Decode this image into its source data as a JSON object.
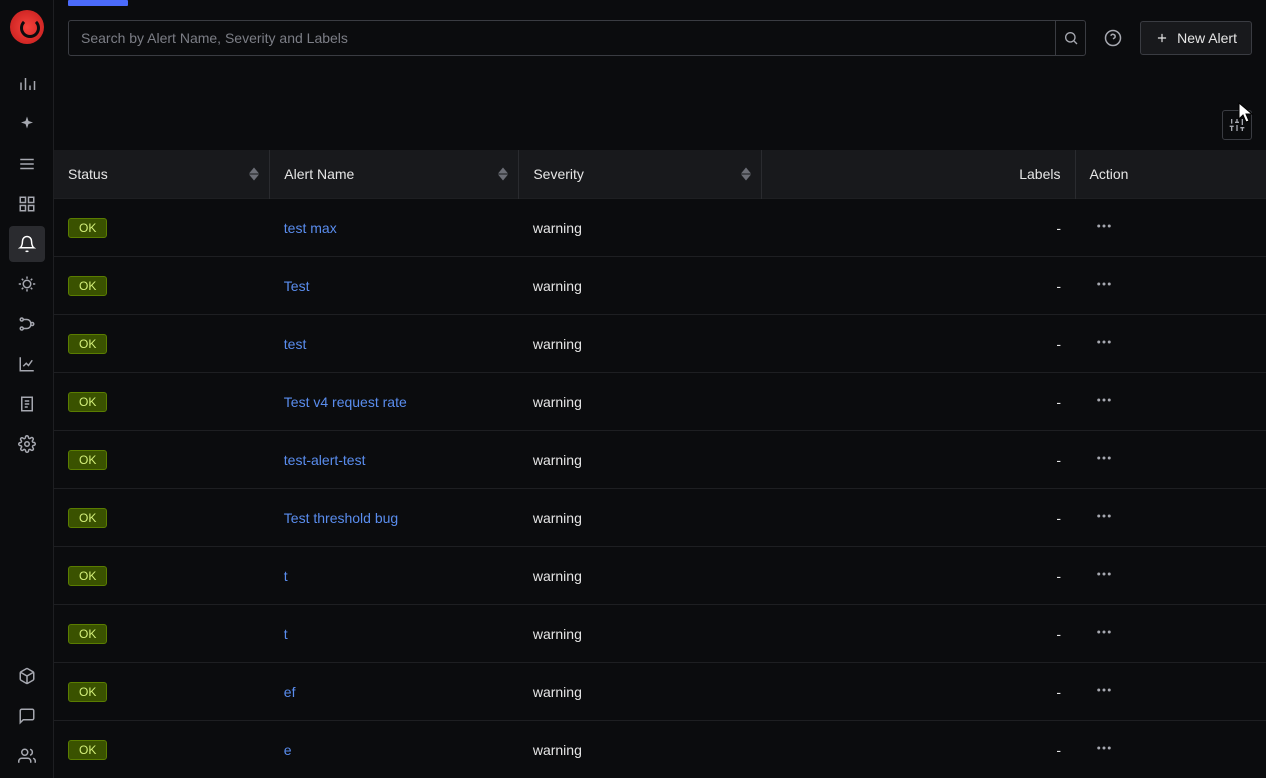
{
  "search": {
    "placeholder": "Search by Alert Name, Severity and Labels",
    "value": ""
  },
  "button": {
    "new_alert": "New Alert"
  },
  "columns": {
    "status": "Status",
    "alert_name": "Alert Name",
    "severity": "Severity",
    "labels": "Labels",
    "action": "Action"
  },
  "status_label": "OK",
  "rows": [
    {
      "name": "test max",
      "severity": "warning",
      "labels": "-"
    },
    {
      "name": "Test",
      "severity": "warning",
      "labels": "-"
    },
    {
      "name": "test",
      "severity": "warning",
      "labels": "-"
    },
    {
      "name": "Test v4 request rate",
      "severity": "warning",
      "labels": "-"
    },
    {
      "name": "test-alert-test",
      "severity": "warning",
      "labels": "-"
    },
    {
      "name": "Test threshold bug",
      "severity": "warning",
      "labels": "-"
    },
    {
      "name": "t",
      "severity": "warning",
      "labels": "-"
    },
    {
      "name": "t",
      "severity": "warning",
      "labels": "-"
    },
    {
      "name": "ef",
      "severity": "warning",
      "labels": "-"
    },
    {
      "name": "e",
      "severity": "warning",
      "labels": "-"
    }
  ]
}
